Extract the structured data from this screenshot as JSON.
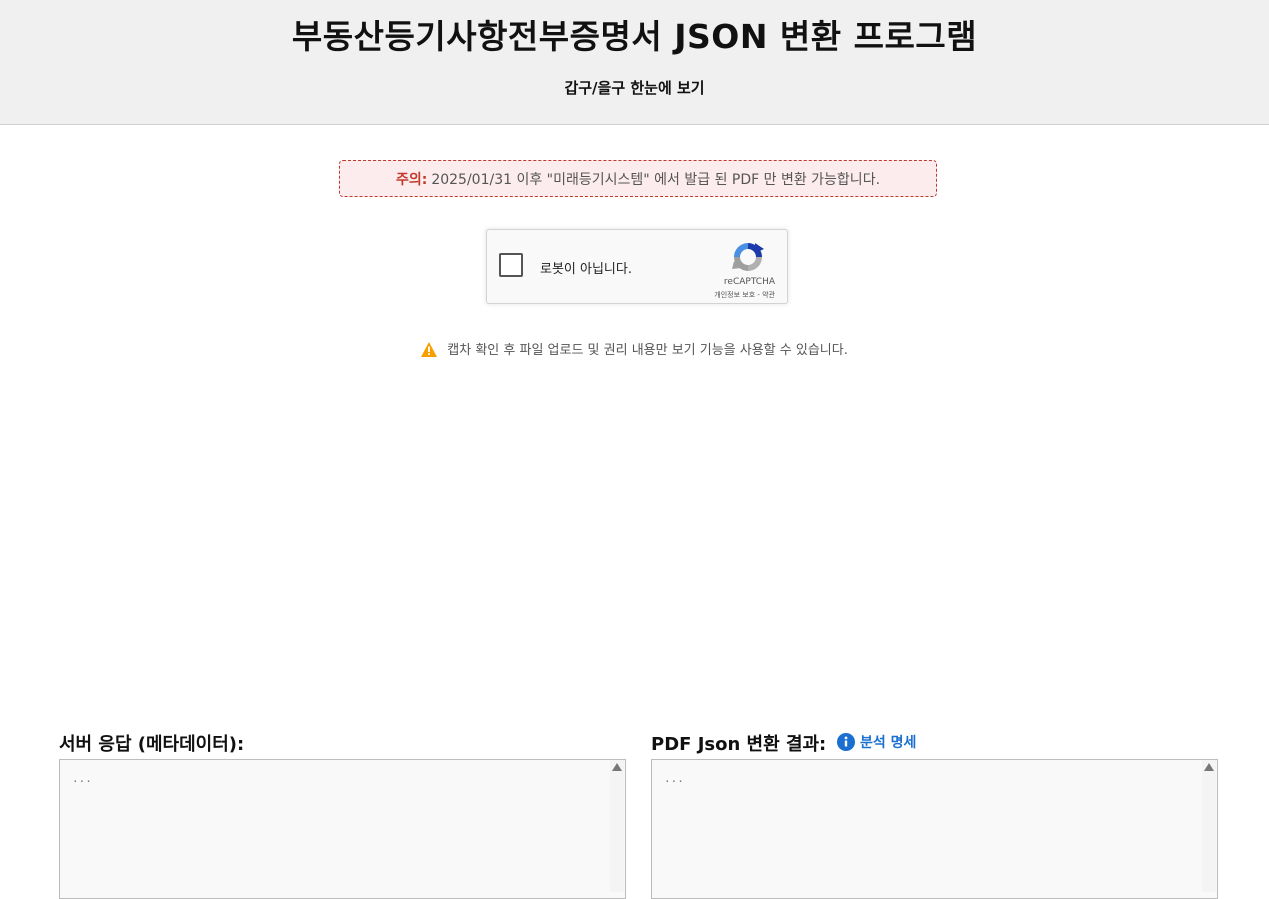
{
  "header": {
    "title": "부동산등기사항전부증명서 JSON 변환 프로그램",
    "subtitle": "갑구/을구 한눈에 보기"
  },
  "notice": {
    "label": "주의:",
    "text": "2025/01/31 이후 \"미래등기시스템\" 에서 발급 된 PDF 만 변환 가능합니다."
  },
  "recaptcha": {
    "label": "로봇이 아닙니다.",
    "brand": "reCAPTCHA",
    "links": "개인정보 보호 - 약관"
  },
  "warning": {
    "icon": "warning-triangle-icon",
    "text": "캡차 확인 후 파일 업로드 및 권리 내용만 보기 기능을 사용할 수 있습니다."
  },
  "left_panel": {
    "title": "서버 응답 (메타데이터):",
    "content": "..."
  },
  "right_panel": {
    "title": "PDF Json 변환 결과:",
    "info_link": "분석 명세",
    "content": "..."
  },
  "colors": {
    "accent_link": "#1a6fd1",
    "notice_red": "#c0392b",
    "warning_orange": "#f5a000"
  }
}
